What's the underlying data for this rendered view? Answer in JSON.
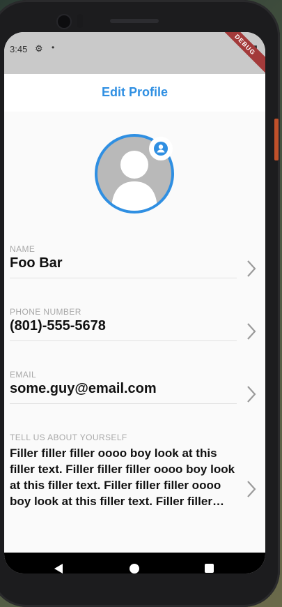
{
  "status_bar": {
    "time": "3:45",
    "debug_banner": "DEBUG"
  },
  "app_bar": {
    "title": "Edit Profile"
  },
  "avatar": {
    "alt": "profile picture",
    "badge_icon": "account-circle-icon"
  },
  "fields": {
    "name": {
      "label": "NAME",
      "value": "Foo Bar"
    },
    "phone": {
      "label": "PHONE NUMBER",
      "value": "(801)-555-5678"
    },
    "email": {
      "label": "EMAIL",
      "value": "some.guy@email.com"
    },
    "about": {
      "label": "TELL US ABOUT YOURSELF",
      "value": "Filler filler filler oooo boy look at this filler text. Filler filler filler oooo boy look at this filler text. Filler filler filler oooo boy look at this filler text. Filler filler filler oooo boy look at this filler text."
    }
  },
  "colors": {
    "accent": "#2f8fe2",
    "label": "#a8a8a8",
    "background": "#fafafa"
  }
}
